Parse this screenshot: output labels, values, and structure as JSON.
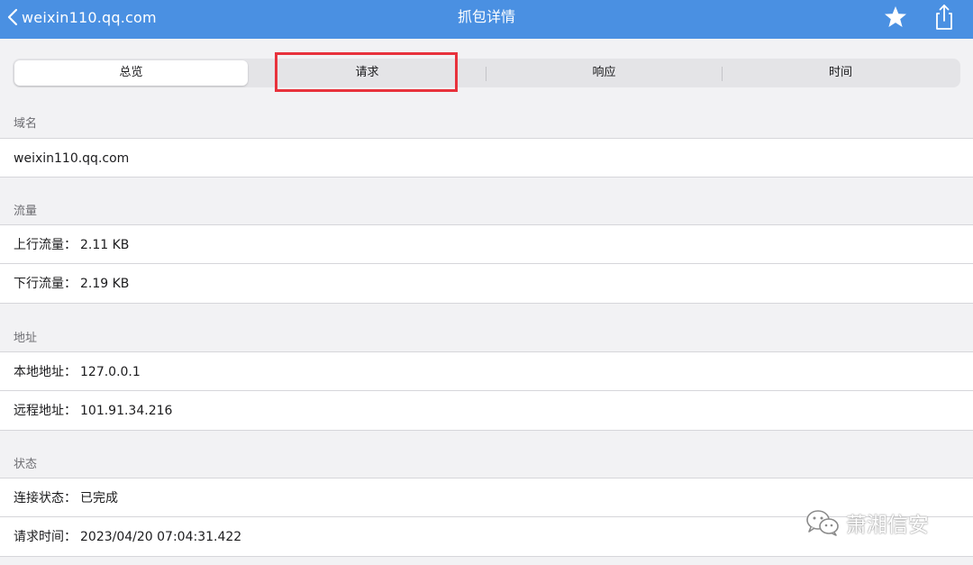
{
  "nav": {
    "back_label": "weixin110.qq.com",
    "title": "抓包详情",
    "icons": [
      "chevron-left-icon",
      "star-icon",
      "share-icon"
    ]
  },
  "tabs": [
    {
      "label": "总览",
      "selected": true
    },
    {
      "label": "请求",
      "selected": false
    },
    {
      "label": "响应",
      "selected": false
    },
    {
      "label": "时间",
      "selected": false
    }
  ],
  "sections": {
    "domain": {
      "header": "域名",
      "rows": [
        {
          "label": "",
          "value": "weixin110.qq.com"
        }
      ]
    },
    "traffic": {
      "header": "流量",
      "rows": [
        {
          "label": "上行流量：",
          "value": "2.11 KB"
        },
        {
          "label": "下行流量：",
          "value": "2.19 KB"
        }
      ]
    },
    "address": {
      "header": "地址",
      "rows": [
        {
          "label": "本地地址：",
          "value": "127.0.0.1"
        },
        {
          "label": "远程地址：",
          "value": "101.91.34.216"
        }
      ]
    },
    "status": {
      "header": "状态",
      "rows": [
        {
          "label": "连接状态：",
          "value": "已完成"
        },
        {
          "label": "请求时间：",
          "value": "2023/04/20 07:04:31.422"
        }
      ]
    }
  },
  "watermark": {
    "text": "萧湘信安"
  },
  "colors": {
    "nav_bg": "#4a90e2",
    "highlight": "#e8323c",
    "page_bg": "#f2f2f4"
  }
}
